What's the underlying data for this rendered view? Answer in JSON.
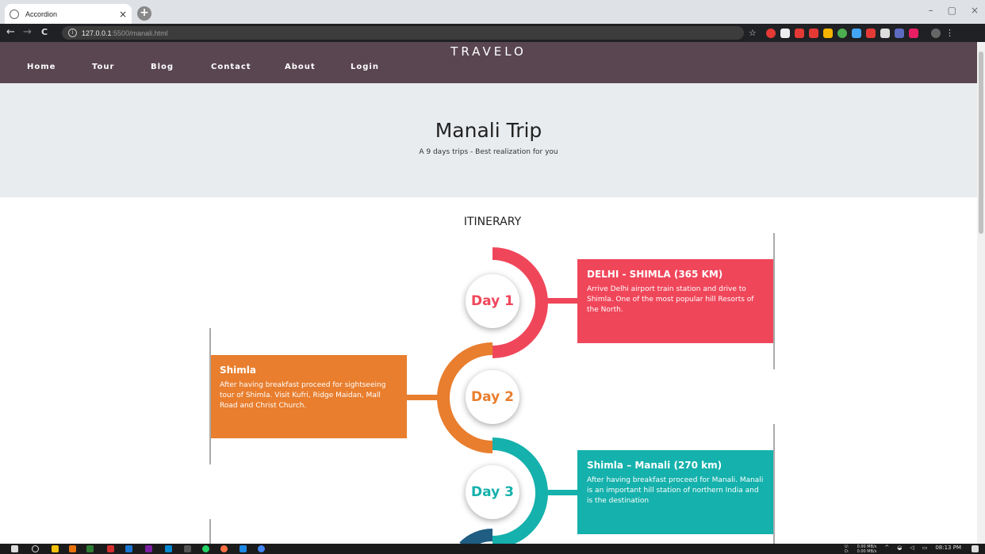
{
  "browser": {
    "tab_title": "Accordion",
    "tab_close": "×",
    "new_tab": "+",
    "url_host": "127.0.0.1",
    "url_path": ":5500/manali.html",
    "back": "←",
    "forward": "→",
    "reload": "C",
    "star": "☆",
    "minimize": "–",
    "maximize": "▢",
    "close": "×"
  },
  "site": {
    "brand": "TRAVELO",
    "nav": [
      "Home",
      "Tour",
      "Blog",
      "Contact",
      "About",
      "Login"
    ]
  },
  "hero": {
    "title": "Manali Trip",
    "subtitle": "A 9 days trips - Best realization for you"
  },
  "itinerary": {
    "title": "ITINERARY",
    "days": [
      {
        "label": "Day 1",
        "color": "#f0465a",
        "heading": "DELHI - SHIMLA (365 KM)",
        "text": "Arrive Delhi airport train station and drive to Shimla. One of the most popular hill Resorts of the North."
      },
      {
        "label": "Day 2",
        "color": "#e87e2e",
        "heading": "Shimla",
        "text": "After having breakfast proceed for sightseeing tour of Shimla. Visit Kufri, Ridge Maidan, Mall Road and Christ Church."
      },
      {
        "label": "Day 3",
        "color": "#15b1ac",
        "heading": "Shimla – Manali (270 km)",
        "text": "After having breakfast proceed for Manali. Manali is an important hill station of northern India and is the destination"
      }
    ]
  },
  "taskbar": {
    "net_up": "U:",
    "net_down": "D:",
    "net_up_speed": "0.00 MB/s",
    "net_down_speed": "0.00 MB/s",
    "time": "08:13 PM"
  }
}
